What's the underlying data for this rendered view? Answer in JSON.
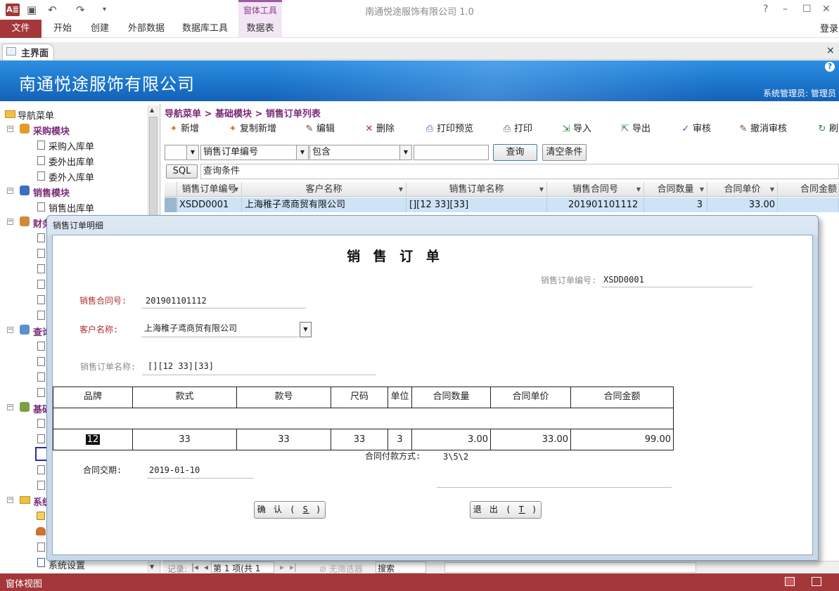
{
  "app": {
    "window_title": "南通悦途服饰有限公司 1.0",
    "logo_text": "A≣",
    "tool_context": "窗体工具",
    "login": "登录",
    "help": "?",
    "minimize": "–",
    "maximize": "☐",
    "close": "✕"
  },
  "ribbon": {
    "tabs": [
      "文件",
      "开始",
      "创建",
      "外部数据",
      "数据库工具",
      "数据表"
    ]
  },
  "doc_tab": {
    "label": "主界面",
    "close": "×"
  },
  "banner": {
    "title": "南通悦途服饰有限公司",
    "user": "系统管理员: 管理员"
  },
  "nav": {
    "root": "导航菜单",
    "items": [
      {
        "label": "采购模块"
      },
      {
        "label": "采购入库单"
      },
      {
        "label": "委外出库单"
      },
      {
        "label": "委外入库单"
      },
      {
        "label": "销售模块"
      },
      {
        "label": "销售出库单"
      },
      {
        "label": "财务"
      },
      {
        "label": "查询"
      },
      {
        "label": "基础"
      },
      {
        "label": "系统"
      },
      {
        "label": "系统设置"
      }
    ]
  },
  "main": {
    "breadcrumb": "导航菜单 > 基础模块 > 销售订单列表",
    "toolbar": [
      {
        "label": "新增",
        "icon": "✦"
      },
      {
        "label": "复制新增",
        "icon": "✦"
      },
      {
        "label": "编辑",
        "icon": "✎"
      },
      {
        "label": "删除",
        "icon": "✕"
      },
      {
        "label": "打印预览",
        "icon": "⎙"
      },
      {
        "label": "打印",
        "icon": "⎙"
      },
      {
        "label": "导入",
        "icon": "⇲"
      },
      {
        "label": "导出",
        "icon": "⇱"
      },
      {
        "label": "审核",
        "icon": "✓"
      },
      {
        "label": "撤消审核",
        "icon": "✎"
      },
      {
        "label": "刷",
        "icon": "↻"
      }
    ],
    "filter": {
      "field": "销售订单编号",
      "operator": "包含",
      "value": "",
      "query_btn": "查询",
      "clear_btn": "清空条件",
      "sql_btn": "SQL",
      "condition_label": "查询条件"
    },
    "grid": {
      "columns": [
        "销售订单编号",
        "客户名称",
        "销售订单名称",
        "销售合同号",
        "合同数量",
        "合同单价",
        "合同金额"
      ],
      "rows": [
        [
          "XSDD0001",
          "上海稚子鸢商贸有限公司",
          "[][12 33][33]",
          "201901101112",
          "3",
          "33.00",
          ""
        ]
      ]
    },
    "record_bar": {
      "label": "记录:",
      "position": "第 1 项(共 1 项)",
      "filter": "无筛选器",
      "search": "搜索"
    }
  },
  "dialog": {
    "title": "销售订单明细",
    "heading": "销 售 订 单",
    "order_no_label": "销售订单编号:",
    "order_no": "XSDD0001",
    "contract_no_label": "销售合同号:",
    "contract_no": "201901101112",
    "customer_label": "客户名称:",
    "customer": "上海稚子鸢商贸有限公司",
    "order_name_label": "销售订单名称:",
    "order_name": "[][12 33][33]",
    "table": {
      "headers": [
        "品牌",
        "款式",
        "款号",
        "尺码",
        "单位",
        "合同数量",
        "合同单价",
        "合同金额"
      ],
      "rows": [
        [
          "12",
          "33",
          "33",
          "33",
          "3",
          "3.00",
          "33.00",
          "99.00"
        ]
      ]
    },
    "payment_label": "合同付款方式:",
    "payment": "3\\5\\2",
    "delivery_label": "合同交期:",
    "delivery": "2019-01-10",
    "confirm_btn": {
      "text": "确 认 ( ",
      "key": "S",
      "end": " )"
    },
    "exit_btn": {
      "text": "退 出 ( ",
      "key": "T",
      "end": " )"
    }
  },
  "status": {
    "text": "窗体视图"
  }
}
